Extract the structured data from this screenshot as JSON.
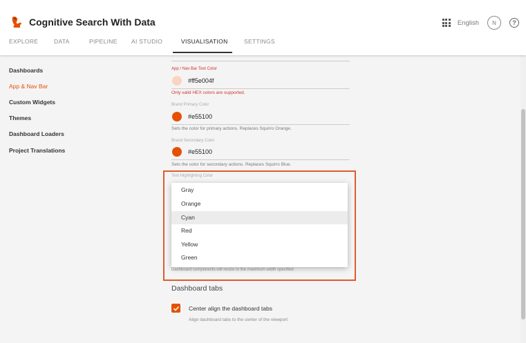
{
  "app": {
    "title": "Cognitive Search With Data",
    "brand_color": "#e55100"
  },
  "header": {
    "language": "English",
    "avatar_initial": "N",
    "help_glyph": "?"
  },
  "tabs": [
    "EXPLORE",
    "DATA",
    "PIPELINE",
    "AI STUDIO",
    "VISUALISATION",
    "SETTINGS"
  ],
  "active_tab": "VISUALISATION",
  "sidebar": {
    "items": [
      {
        "label": "Dashboards"
      },
      {
        "label": "App & Nav Bar",
        "active": true
      },
      {
        "label": "Custom Widgets"
      },
      {
        "label": "Themes"
      },
      {
        "label": "Dashboard Loaders"
      },
      {
        "label": "Project Translations"
      }
    ]
  },
  "form": {
    "partial_value": "#ff...",
    "nav_text_color": {
      "label": "App / Nav Bar Text Color",
      "value": "#ff5e004f",
      "swatch": "#fbd4c1",
      "error": "Only valid HEX colors are supported."
    },
    "brand_primary": {
      "label": "Brand Primary Color",
      "value": "#e55100",
      "swatch": "#e55100",
      "helper": "Sets the color for primary actions. Replaces Squirro Orange."
    },
    "brand_secondary": {
      "label": "Brand Secondary Color",
      "value": "#e55100",
      "swatch": "#e55100",
      "helper": "Sets the color for secondary actions. Replaces Squirro Blue."
    },
    "text_highlighting": {
      "label": "Text Highlighting Color",
      "options": [
        "Gray",
        "Orange",
        "Cyan",
        "Red",
        "Yellow",
        "Green"
      ],
      "hovered": "Cyan"
    },
    "width_helper": "Dashboard components will resize to the maximum width specified"
  },
  "dashboard_tabs": {
    "title": "Dashboard tabs",
    "checkbox_label": "Center align the dashboard tabs",
    "checkbox_helper": "Align dashboard tabs to the center of the viewport",
    "checked": true
  },
  "highlight_color": "#e05a2b"
}
